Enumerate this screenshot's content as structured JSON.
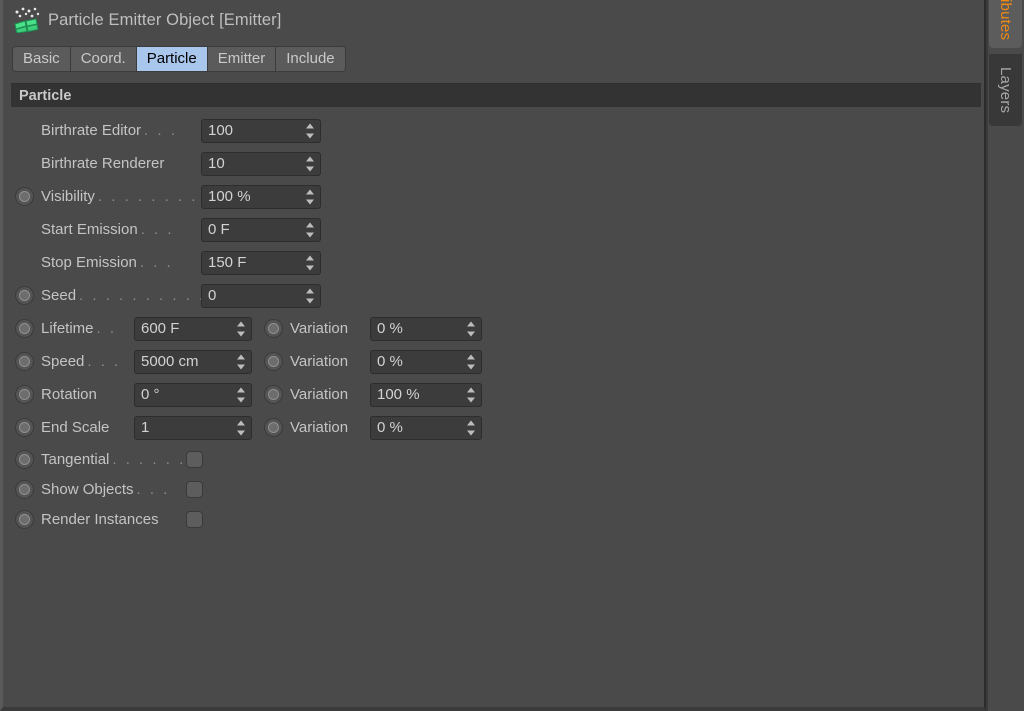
{
  "window": {
    "title": "Particle Emitter Object [Emitter]",
    "icon": "particle-emitter-icon"
  },
  "tabs": [
    {
      "label": "Basic",
      "active": false
    },
    {
      "label": "Coord.",
      "active": false
    },
    {
      "label": "Particle",
      "active": true
    },
    {
      "label": "Emitter",
      "active": false
    },
    {
      "label": "Include",
      "active": false
    }
  ],
  "group": {
    "title": "Particle"
  },
  "parameters": [
    {
      "name": "birthrate-editor",
      "label": "Birthrate Editor",
      "leader": ". . .",
      "anim": false,
      "type": "number",
      "value": "100"
    },
    {
      "name": "birthrate-renderer",
      "label": "Birthrate Renderer",
      "leader": "",
      "anim": false,
      "type": "number",
      "value": "10"
    },
    {
      "name": "visibility",
      "label": "Visibility",
      "leader": ". . . . . . . .",
      "anim": true,
      "type": "number",
      "value": "100 %"
    },
    {
      "name": "start-emission",
      "label": "Start Emission",
      "leader": ". . .",
      "anim": false,
      "type": "number",
      "value": "0 F"
    },
    {
      "name": "stop-emission",
      "label": "Stop Emission",
      "leader": ". . .",
      "anim": false,
      "type": "number",
      "value": "150 F"
    },
    {
      "name": "seed",
      "label": "Seed",
      "leader": ". . . . . . . . . .",
      "anim": true,
      "type": "number",
      "value": "0"
    }
  ],
  "paired_parameters": [
    {
      "name": "lifetime",
      "label": "Lifetime",
      "leader": ". .",
      "anim": true,
      "value": "600 F",
      "variation": {
        "label": "Variation",
        "anim": true,
        "value": "0 %"
      }
    },
    {
      "name": "speed",
      "label": "Speed",
      "leader": ". . .",
      "anim": true,
      "value": "5000 cm",
      "variation": {
        "label": "Variation",
        "anim": true,
        "value": "0 %"
      }
    },
    {
      "name": "rotation",
      "label": "Rotation",
      "leader": "",
      "anim": true,
      "value": "0 °",
      "variation": {
        "label": "Variation",
        "anim": true,
        "value": "100 %"
      }
    },
    {
      "name": "end-scale",
      "label": "End Scale",
      "leader": "",
      "anim": true,
      "value": "1",
      "variation": {
        "label": "Variation",
        "anim": true,
        "value": "0 %"
      }
    }
  ],
  "toggles": [
    {
      "name": "tangential",
      "label": "Tangential",
      "leader": ". . . . . .",
      "anim": true,
      "checked": false
    },
    {
      "name": "show-objects",
      "label": "Show Objects",
      "leader": ". . .",
      "anim": true,
      "checked": false
    },
    {
      "name": "render-instances",
      "label": "Render Instances",
      "leader": "",
      "anim": true,
      "checked": false
    }
  ],
  "dock": {
    "tabs": [
      {
        "name": "attributes",
        "label": "ibutes",
        "color": "#f08a12"
      },
      {
        "name": "layers",
        "label": "Layers",
        "color": "#a8a8a8"
      }
    ]
  },
  "colors": {
    "panel_bg": "#4a4a4a",
    "group_header_bg": "#333333",
    "field_bg": "#3c3c3c",
    "active_tab_bg": "#a9c6ec",
    "accent_orange": "#f08a12",
    "icon_green": "#4ce08a"
  }
}
